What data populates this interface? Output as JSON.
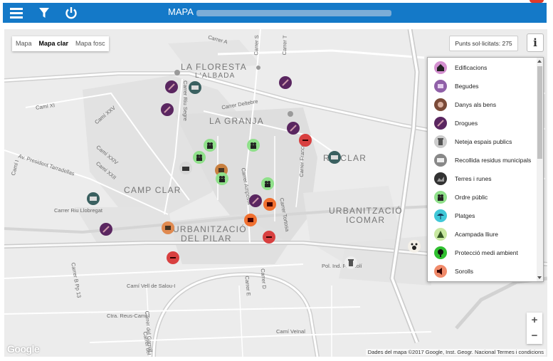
{
  "header": {
    "title": "MAPA",
    "menu_icon": "hamburger-icon",
    "filter_icon": "funnel-icon",
    "power_icon": "power-icon",
    "bar_color": "#1479c8"
  },
  "map_type": {
    "options": [
      "Mapa",
      "Mapa clar",
      "Mapa fosc"
    ],
    "selected": "Mapa clar"
  },
  "points_requested": "Punts sol·licitats: 275",
  "info_button": "i",
  "legend": {
    "items": [
      {
        "label": "Edificacions",
        "icon": "house-icon",
        "color": "#d490d0"
      },
      {
        "label": "Begudes",
        "icon": "cup-icon",
        "color": "#9060a8"
      },
      {
        "label": "Danys als bens",
        "icon": "damage-icon",
        "color": "#7a4a38"
      },
      {
        "label": "Drogues",
        "icon": "syringe-icon",
        "color": "#5a2660"
      },
      {
        "label": "Neteja espais publics",
        "icon": "trash-icon",
        "color": "#cccccc"
      },
      {
        "label": "Recollida residus municipals",
        "icon": "truck-icon",
        "color": "#888888"
      },
      {
        "label": "Terres i runes",
        "icon": "rubble-icon",
        "color": "#333333"
      },
      {
        "label": "Ordre públic",
        "icon": "people-icon",
        "color": "#8fe08a"
      },
      {
        "label": "Platges",
        "icon": "beach-icon",
        "color": "#40c8d8"
      },
      {
        "label": "Acampada lliure",
        "icon": "tent-icon",
        "color": "#c8e8a0"
      },
      {
        "label": "Protecció medi ambient",
        "icon": "tree-icon",
        "color": "#30c030"
      },
      {
        "label": "Sorolls",
        "icon": "speaker-icon",
        "color": "#f08a6a"
      }
    ]
  },
  "map_labels": {
    "la_floresta": "LA FLORESTA",
    "l_albada": "L'ALBADA",
    "la_granja": "LA GRANJA",
    "camp_clar": "CAMP CLAR",
    "riuclar": "RIUCLAR",
    "urb_pilar_1": "URBANITZACIÓ",
    "urb_pilar_2": "DEL PILAR",
    "urb_icomar_1": "URBANITZACIÓ",
    "urb_icomar_2": "ICOMAR",
    "carrer_a": "Carrer A",
    "carrer_s": "Carrer S",
    "carrer_t": "Carrer T",
    "cami_xi": "Camí XI",
    "cami_xxv": "Camí XXV",
    "carrer_deltebre": "Carrer Deltebre",
    "carrer_riu_segre": "Carrer Riu Segre",
    "cami_xxiv": "Camí XXIV",
    "cami_xxii": "Camí XXII",
    "cami_i": "Camí I",
    "av_president": "Av. President Tarradellas",
    "carrer_francoli": "Carrer Francolí",
    "carrer_amposta": "Carrer Amposta",
    "carrer_riu_llobregat": "Carrer Riu Llobregat",
    "carrer_tortosa": "Carrer Tortosa",
    "carrer_b_pp13": "Carrer B Pp 13",
    "cami_vell_salou": "Camí Vell de Salou-I",
    "pol_ind": "Pol. Ind. Francolí",
    "carrer_e": "Carrer E",
    "carrer_d": "Carrer D",
    "ctra_reus": "Ctra. Reus-Camí I",
    "carrer_del_garrell": "Carrer del Garrell",
    "carrer_del_plom": "Carrer del Plom",
    "cami_veinal": "Camí Veïnal"
  },
  "zoom": {
    "plus": "+",
    "minus": "−"
  },
  "attribution": "Dades del mapa ©2017 Google, Inst. Geogr. Nacional   Termes i condicions",
  "google_logo": "Google"
}
